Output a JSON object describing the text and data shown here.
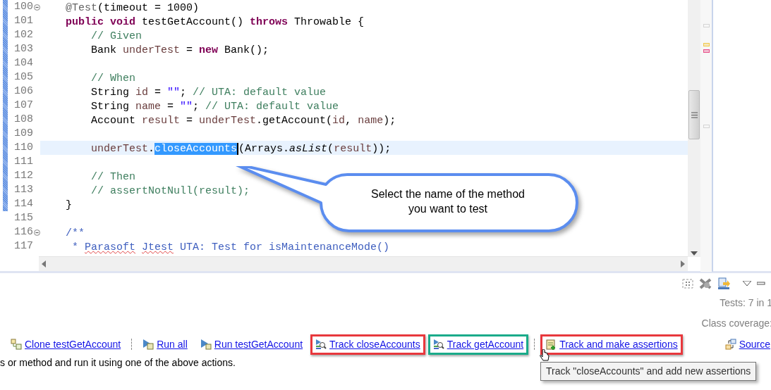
{
  "editor": {
    "lines": [
      {
        "number": "100",
        "changed": true,
        "fold_icon": true,
        "current": false,
        "segments": [
          {
            "kind": "annotation",
            "text": "    @Test"
          },
          {
            "kind": "plain",
            "text": "(timeout = 1000)"
          }
        ]
      },
      {
        "number": "101",
        "changed": true,
        "fold_icon": false,
        "current": false,
        "segments": [
          {
            "kind": "keyword",
            "text": "    public void"
          },
          {
            "kind": "plain",
            "text": " testGetAccount() "
          },
          {
            "kind": "keyword",
            "text": "throws"
          },
          {
            "kind": "plain",
            "text": " Throwable {"
          }
        ]
      },
      {
        "number": "102",
        "changed": true,
        "fold_icon": false,
        "current": false,
        "segments": [
          {
            "kind": "comment",
            "text": "        // Given"
          }
        ]
      },
      {
        "number": "103",
        "changed": true,
        "fold_icon": false,
        "current": false,
        "segments": [
          {
            "kind": "plain",
            "text": "        Bank "
          },
          {
            "kind": "variable",
            "text": "underTest"
          },
          {
            "kind": "plain",
            "text": " = "
          },
          {
            "kind": "keyword",
            "text": "new"
          },
          {
            "kind": "plain",
            "text": " Bank();"
          }
        ]
      },
      {
        "number": "104",
        "changed": true,
        "fold_icon": false,
        "current": false
      },
      {
        "number": "105",
        "changed": true,
        "fold_icon": false,
        "current": false,
        "segments": [
          {
            "kind": "comment",
            "text": "        // When"
          }
        ]
      },
      {
        "number": "106",
        "changed": true,
        "fold_icon": false,
        "current": false,
        "segments": [
          {
            "kind": "plain",
            "text": "        String "
          },
          {
            "kind": "variable",
            "text": "id"
          },
          {
            "kind": "plain",
            "text": " = "
          },
          {
            "kind": "string",
            "text": "\"\""
          },
          {
            "kind": "plain",
            "text": "; "
          },
          {
            "kind": "comment",
            "text": "// UTA: default value"
          }
        ]
      },
      {
        "number": "107",
        "changed": true,
        "fold_icon": false,
        "current": false,
        "segments": [
          {
            "kind": "plain",
            "text": "        String "
          },
          {
            "kind": "variable",
            "text": "name"
          },
          {
            "kind": "plain",
            "text": " = "
          },
          {
            "kind": "string",
            "text": "\"\""
          },
          {
            "kind": "plain",
            "text": "; "
          },
          {
            "kind": "comment",
            "text": "// UTA: default value"
          }
        ]
      },
      {
        "number": "108",
        "changed": true,
        "fold_icon": false,
        "current": false,
        "segments": [
          {
            "kind": "plain",
            "text": "        Account "
          },
          {
            "kind": "variable",
            "text": "result"
          },
          {
            "kind": "plain",
            "text": " = "
          },
          {
            "kind": "variable",
            "text": "underTest"
          },
          {
            "kind": "plain",
            "text": ".getAccount("
          },
          {
            "kind": "variable",
            "text": "id"
          },
          {
            "kind": "plain",
            "text": ", "
          },
          {
            "kind": "variable",
            "text": "name"
          },
          {
            "kind": "plain",
            "text": ");"
          }
        ]
      },
      {
        "number": "109",
        "changed": true,
        "fold_icon": false,
        "current": false
      },
      {
        "number": "110",
        "changed": true,
        "fold_icon": false,
        "current": true,
        "segments": [
          {
            "kind": "variable",
            "text": "        underTest"
          },
          {
            "kind": "plain",
            "text": "."
          },
          {
            "kind": "selected",
            "text": "closeAccounts"
          },
          {
            "kind": "plain",
            "text": "(Arrays."
          },
          {
            "kind": "static",
            "text": "asList"
          },
          {
            "kind": "plain",
            "text": "("
          },
          {
            "kind": "variable",
            "text": "result"
          },
          {
            "kind": "plain",
            "text": "));"
          }
        ]
      },
      {
        "number": "111",
        "changed": true,
        "fold_icon": false,
        "current": false
      },
      {
        "number": "112",
        "changed": true,
        "fold_icon": false,
        "current": false,
        "segments": [
          {
            "kind": "comment",
            "text": "        // Then"
          }
        ]
      },
      {
        "number": "113",
        "changed": true,
        "fold_icon": false,
        "current": false,
        "segments": [
          {
            "kind": "comment",
            "text": "        // assertNotNull(result);"
          }
        ]
      },
      {
        "number": "114",
        "changed": true,
        "fold_icon": false,
        "current": false,
        "segments": [
          {
            "kind": "plain",
            "text": "    }"
          }
        ]
      },
      {
        "number": "115",
        "changed": false,
        "fold_icon": false,
        "current": false
      },
      {
        "number": "116",
        "changed": false,
        "fold_icon": true,
        "current": false,
        "segments": [
          {
            "kind": "javadoc",
            "text": "    /**"
          }
        ]
      },
      {
        "number": "117",
        "changed": false,
        "fold_icon": false,
        "current": false,
        "segments": [
          {
            "kind": "javadoc",
            "text": "     * "
          },
          {
            "kind": "misspelled",
            "text": "Parasoft"
          },
          {
            "kind": "misspelled",
            "text": " Jtest"
          },
          {
            "kind": "javadoc",
            "text": " UTA: Test for isMaintenanceMode()"
          }
        ]
      }
    ],
    "overview_marks": [
      {
        "color": "#d4d4d4"
      },
      {
        "color": "#f2c94c"
      },
      {
        "color": "#e8508a"
      },
      {
        "color": "#d4d4d4"
      }
    ],
    "callout": "Select the name of the method\nyou want to test"
  },
  "panel": {
    "stats": [
      "Tests: 7 in 1",
      "Class coverage:"
    ],
    "actions": [
      {
        "kind": "clone",
        "label": "Clone testGetAccount",
        "separator_after": true
      },
      {
        "kind": "run-all",
        "label": "Run all",
        "separator_after": false
      },
      {
        "kind": "run",
        "label": "Run testGetAccount",
        "separator_after": false
      },
      {
        "kind": "track",
        "label": "Track closeAccounts",
        "separator_after": false,
        "color": "#e8383d"
      },
      {
        "kind": "track",
        "label": "Track getAccount",
        "separator_after": true,
        "color": "#1aab8a"
      },
      {
        "kind": "track-assert",
        "label": "Track and make assertions",
        "separator_after": false,
        "color": "#e8383d"
      }
    ],
    "source_link": "Source",
    "hint": "s or method and run it using one of the above actions.",
    "tooltip": "Track \"closeAccounts\" and add new assertions"
  }
}
